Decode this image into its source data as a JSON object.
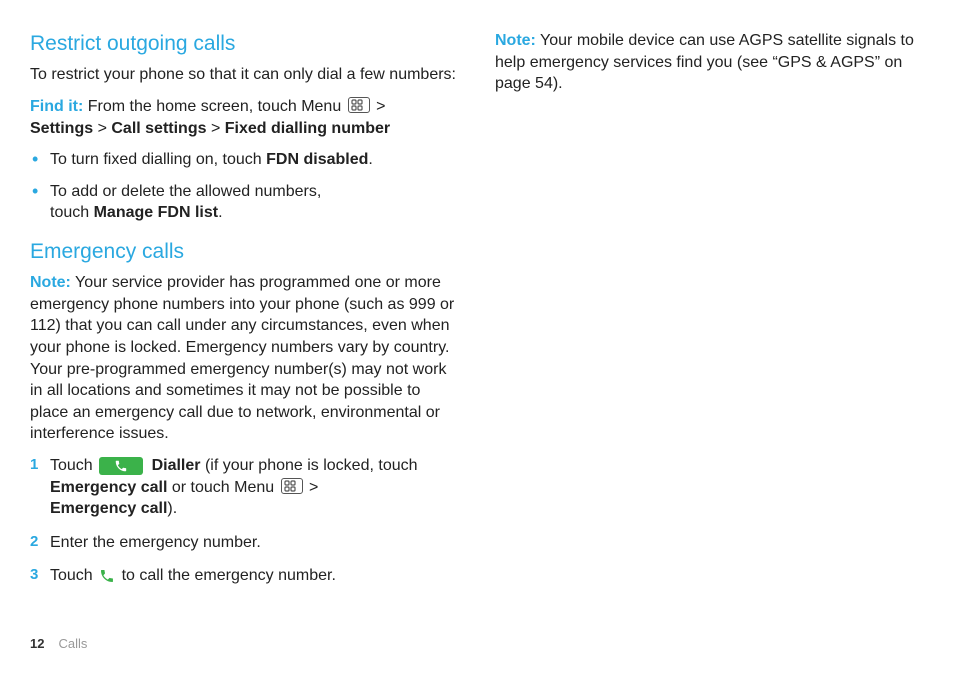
{
  "footer": {
    "page_number": "12",
    "section_label": "Calls"
  },
  "left": {
    "section1": {
      "heading": "Restrict outgoing calls",
      "intro": "To restrict your phone so that it can only dial a few numbers:",
      "findit_label": "Find it:",
      "findit_lead": " From the home screen, touch Menu ",
      "findit_tail_sep1": " > ",
      "findit_settings": "Settings",
      "findit_sep2": " > ",
      "findit_callsettings": "Call settings",
      "findit_sep3": " > ",
      "findit_fdn": "Fixed dialling number",
      "bullets": {
        "b1_pre": "To turn fixed dialling on, touch ",
        "b1_bold": "FDN disabled",
        "b1_post": ".",
        "b2_line1": "To add or delete the allowed numbers,",
        "b2_line2_pre": "touch ",
        "b2_line2_bold": "Manage FDN list",
        "b2_line2_post": "."
      }
    },
    "section2": {
      "heading": "Emergency calls",
      "note_label": "Note:",
      "note_body": " Your service provider has programmed one or more emergency phone numbers into your phone (such as 999 or 112) that you can call under any circumstances, even when your phone is locked. Emergency numbers vary by country. Your pre-programmed emergency number(s) may not work in all locations and sometimes it may not be possible to place an emergency call due to network, environmental or interference issues.",
      "steps": {
        "s1_touch": "Touch ",
        "s1_dialler": " Dialler",
        "s1_post_dialler": " (if your phone is locked, touch ",
        "s1_emcall1": "Emergency call",
        "s1_or": " or touch Menu ",
        "s1_tail_sep": " > ",
        "s1_emcall2": "Emergency call",
        "s1_close": ").",
        "s2": "Enter the emergency number.",
        "s3_pre": "Touch ",
        "s3_post": " to call the emergency number."
      }
    }
  },
  "right": {
    "note_label": "Note:",
    "note_body": " Your mobile device can use AGPS satellite signals to help emergency services find you (see “GPS & AGPS” on page 54)."
  }
}
